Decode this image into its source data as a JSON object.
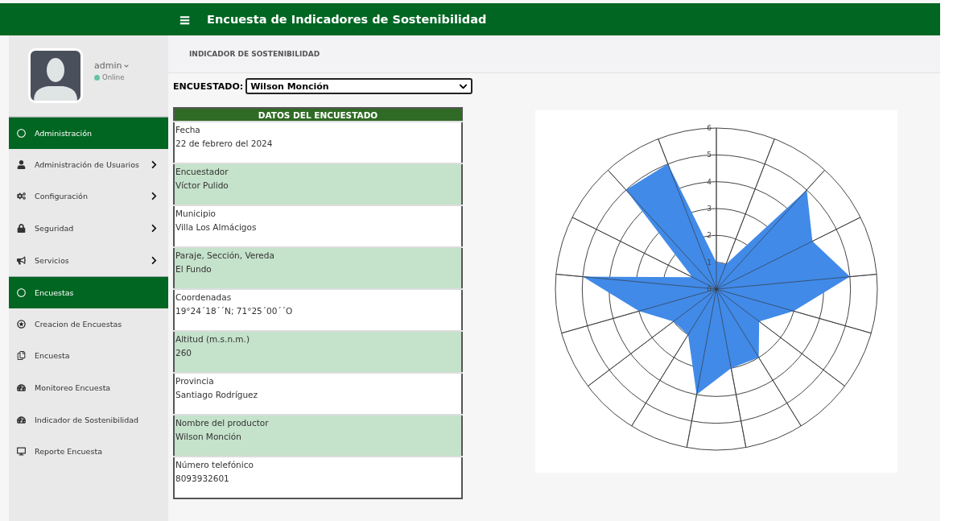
{
  "header": {
    "menu_icon": "≡",
    "title": "Encuesta de Indicadores de Sostenibilidad"
  },
  "user": {
    "name": "admin",
    "status": "Online"
  },
  "sidebar": {
    "items": [
      {
        "kind": "section",
        "label": "Administración",
        "submenu": false
      },
      {
        "kind": "link",
        "label": "Administración de Usuarios",
        "submenu": true
      },
      {
        "kind": "link",
        "label": "Configuración",
        "submenu": true
      },
      {
        "kind": "link",
        "label": "Seguridad",
        "submenu": true
      },
      {
        "kind": "link",
        "label": "Servicios",
        "submenu": true
      },
      {
        "kind": "section",
        "label": "Encuestas",
        "submenu": false
      },
      {
        "kind": "link",
        "label": "Creacion de Encuestas",
        "submenu": false
      },
      {
        "kind": "link",
        "label": "Encuesta",
        "submenu": false
      },
      {
        "kind": "link",
        "label": "Monitoreo Encuesta",
        "submenu": false
      },
      {
        "kind": "link",
        "label": "Indicador de Sostenibilidad",
        "submenu": false
      },
      {
        "kind": "link",
        "label": "Reporte Encuesta",
        "submenu": false
      }
    ]
  },
  "breadcrumb": "INDICADOR DE SOSTENIBILIDAD",
  "respondent_select": {
    "label": "ENCUESTADO:",
    "value": "Wilson Monción"
  },
  "table": {
    "title": "DATOS DEL ENCUESTADO",
    "rows": [
      {
        "label": "Fecha",
        "value": "22 de febrero del 2024"
      },
      {
        "label": "Encuestador",
        "value": "Víctor Pulido"
      },
      {
        "label": "Municipio",
        "value": "Villa Los Almácigos"
      },
      {
        "label": "Paraje, Sección, Vereda",
        "value": "El Fundo"
      },
      {
        "label": "Coordenadas",
        "value": "19°24´18´´N; 71°25´00´´O"
      },
      {
        "label": "Altitud (m.s.n.m.)",
        "value": "260"
      },
      {
        "label": "Provincia",
        "value": "Santiago Rodríguez"
      },
      {
        "label": "Nombre del productor",
        "value": "Wilson Monción"
      },
      {
        "label": "Número telefónico",
        "value": "8093932601"
      }
    ]
  },
  "chart": {
    "tick_labels": [
      "6",
      "5",
      "4",
      "3",
      "2",
      "1",
      "0"
    ]
  }
}
